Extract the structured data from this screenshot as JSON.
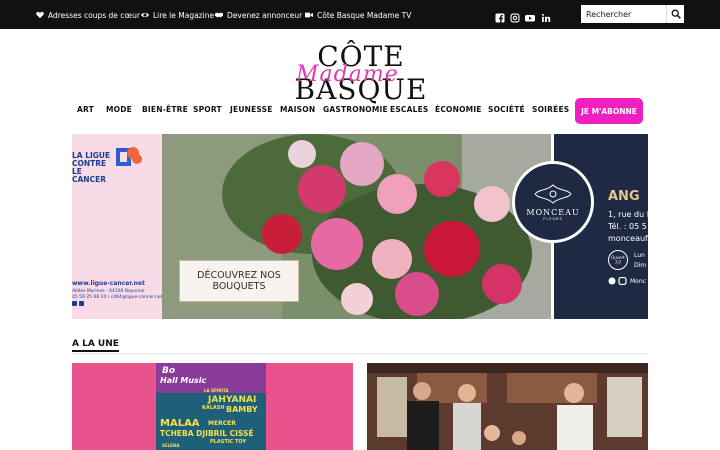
{
  "topbar": {
    "links": [
      {
        "label": "Adresses coups de cœur",
        "icon": "heart-icon"
      },
      {
        "label": "Lire le Magazine",
        "icon": "eye-icon"
      },
      {
        "label": "Devenez annonceur",
        "icon": "handshake-icon"
      },
      {
        "label": "Côte Basque Madame TV",
        "icon": "video-icon"
      }
    ],
    "social": [
      "facebook-icon",
      "instagram-icon",
      "youtube-icon",
      "linkedin-icon"
    ],
    "search_placeholder": "Rechercher"
  },
  "logo": {
    "top": "CÔTE BASQUE",
    "script": "Madame"
  },
  "nav": {
    "items": [
      "ART",
      "MODE",
      "BIEN-ÊTRE",
      "SPORT",
      "JEUNESSE",
      "MAISON",
      "GASTRONOMIE",
      "ESCALES",
      "ÉCONOMIE",
      "SOCIÉTÉ",
      "SOIRÉES"
    ],
    "subscribe": "JE M'ABONNE"
  },
  "banner": {
    "left_ad": {
      "title": "LA LIGUE CONTRE LE CANCER",
      "title_lines": [
        "LA LIGUE",
        "CONTRE",
        "LE CANCER"
      ],
      "url": "www.ligue-cancer.net",
      "address": "Allées Marines - 64100 Bayonne",
      "contact": "05 59 25 68 20 / cd64@ligue-cancer.net"
    },
    "cta_lines": [
      "DÉCOUVREZ NOS",
      "BOUQUETS"
    ],
    "right_ad": {
      "brand": "MONCEAU",
      "brand_sub": "FLEURS",
      "name": "ANG",
      "address": "1, rue du B",
      "phone": "Tél. : 05 5",
      "web": "monceaufl",
      "hours_badge": "Ouvert 7/7",
      "hours_1": "Lun",
      "hours_2": "Dim",
      "social": "Monc"
    }
  },
  "section": {
    "title": "A LA UNE"
  },
  "cards": {
    "left_poster": [
      "Bo",
      "Hall Music",
      "JAHYANAI",
      "KALASH",
      "BAMBY",
      "MALAA",
      "MERCER",
      "TCHEBA DJIBRIL CISSÉ",
      "PLASTIC TOY",
      "SELENA",
      "LA SPIRITA"
    ],
    "colors": {
      "accent": "#f01fbf",
      "topbar": "#111111",
      "ad_navy": "#1e2a44",
      "ad_pink": "#f9dbe7"
    }
  }
}
